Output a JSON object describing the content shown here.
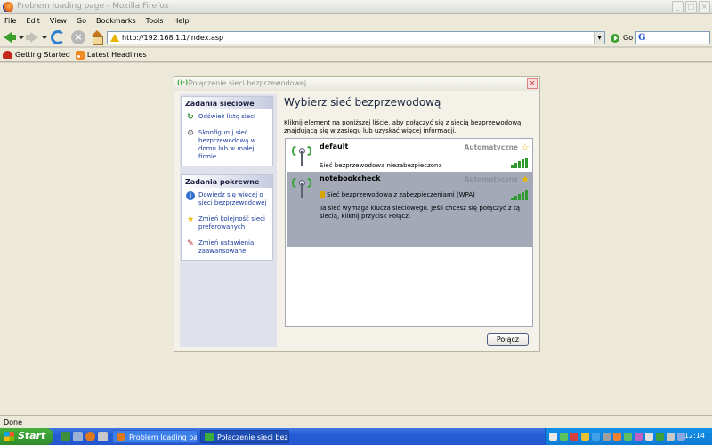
{
  "browser": {
    "title": "Problem loading page - Mozilla Firefox",
    "menu": [
      "File",
      "Edit",
      "View",
      "Go",
      "Bookmarks",
      "Tools",
      "Help"
    ],
    "url": "http://192.168.1.1/index.asp",
    "go_label": "Go",
    "bookmarks": [
      "Getting Started",
      "Latest Headlines"
    ],
    "status": "Done"
  },
  "dialog": {
    "title": "Połączenie sieci bezprzewodowej",
    "heading": "Wybierz sieć bezprzewodową",
    "description": "Kliknij element na poniższej liście, aby połączyć się z siecią bezprzewodową znajdującą się w zasięgu lub uzyskać więcej informacji.",
    "tasks_network": {
      "header": "Zadania sieciowe",
      "items": [
        "Odśwież listę sieci",
        "Skonfiguruj sieć bezprzewodową w domu lub w małej firmie"
      ]
    },
    "tasks_related": {
      "header": "Zadania pokrewne",
      "items": [
        "Dowiedz się więcej o sieci bezprzewodowej",
        "Zmień kolejność sieci preferowanych",
        "Zmień ustawienia zaawansowane"
      ]
    },
    "networks": [
      {
        "name": "default",
        "mode": "Automatyczne",
        "status": "Sieć bezprzewodowa niezabezpieczona",
        "extra": ""
      },
      {
        "name": "notebookcheck",
        "mode": "Automatyczne",
        "status": "Sieć bezprzewodowa z zabezpieczeniami (WPA)",
        "extra": "Ta sieć wymaga klucza sieciowego. Jeśli chcesz się połączyć z tą siecią, kliknij przycisk Połącz."
      }
    ],
    "connect_label": "Połącz"
  },
  "taskbar": {
    "start_label": "Start",
    "tasks": [
      "Problem loading page...",
      "Połączenie sieci bezprz..."
    ],
    "clock": "12:14"
  },
  "colors": {
    "accent": "#245dd6",
    "signal": "#2e9a2e",
    "link": "#1b3e9c"
  }
}
